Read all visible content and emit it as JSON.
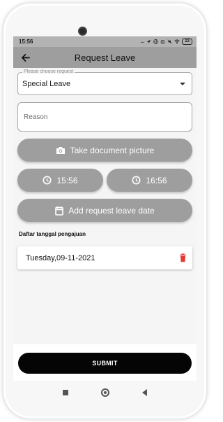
{
  "status_bar": {
    "time": "15:56",
    "icons": [
      "dots-icon",
      "location-arrow-icon",
      "vibrate-icon",
      "alarm-icon",
      "silent-icon",
      "wifi-icon",
      "battery-icon"
    ],
    "dots": "...",
    "battery": "23"
  },
  "app_bar": {
    "title": "Request Leave",
    "back_icon": "arrow-left-icon"
  },
  "form": {
    "leave_type": {
      "label": "Please choose request",
      "value": "Special Leave"
    },
    "reason": {
      "placeholder": "Reason",
      "value": ""
    },
    "document_button": {
      "label": "Take document picture",
      "icon": "camera-icon"
    },
    "start_time": {
      "label": "15:56",
      "icon": "clock-icon"
    },
    "end_time": {
      "label": "16:56",
      "icon": "clock-icon"
    },
    "add_date_button": {
      "label": "Add request leave date",
      "icon": "calendar-icon"
    }
  },
  "dates_section": {
    "label": "Daftar tanggal pengajuan",
    "items": [
      {
        "date": "Tuesday,09-11-2021",
        "delete_icon": "trash-icon"
      }
    ]
  },
  "submit_label": "SUBMIT",
  "colors": {
    "button_grey": "#9e9e9e",
    "app_bar": "#9e9e9e",
    "status_bar": "#b3b3b3",
    "submit": "#050505",
    "delete_red": "#e53935"
  }
}
